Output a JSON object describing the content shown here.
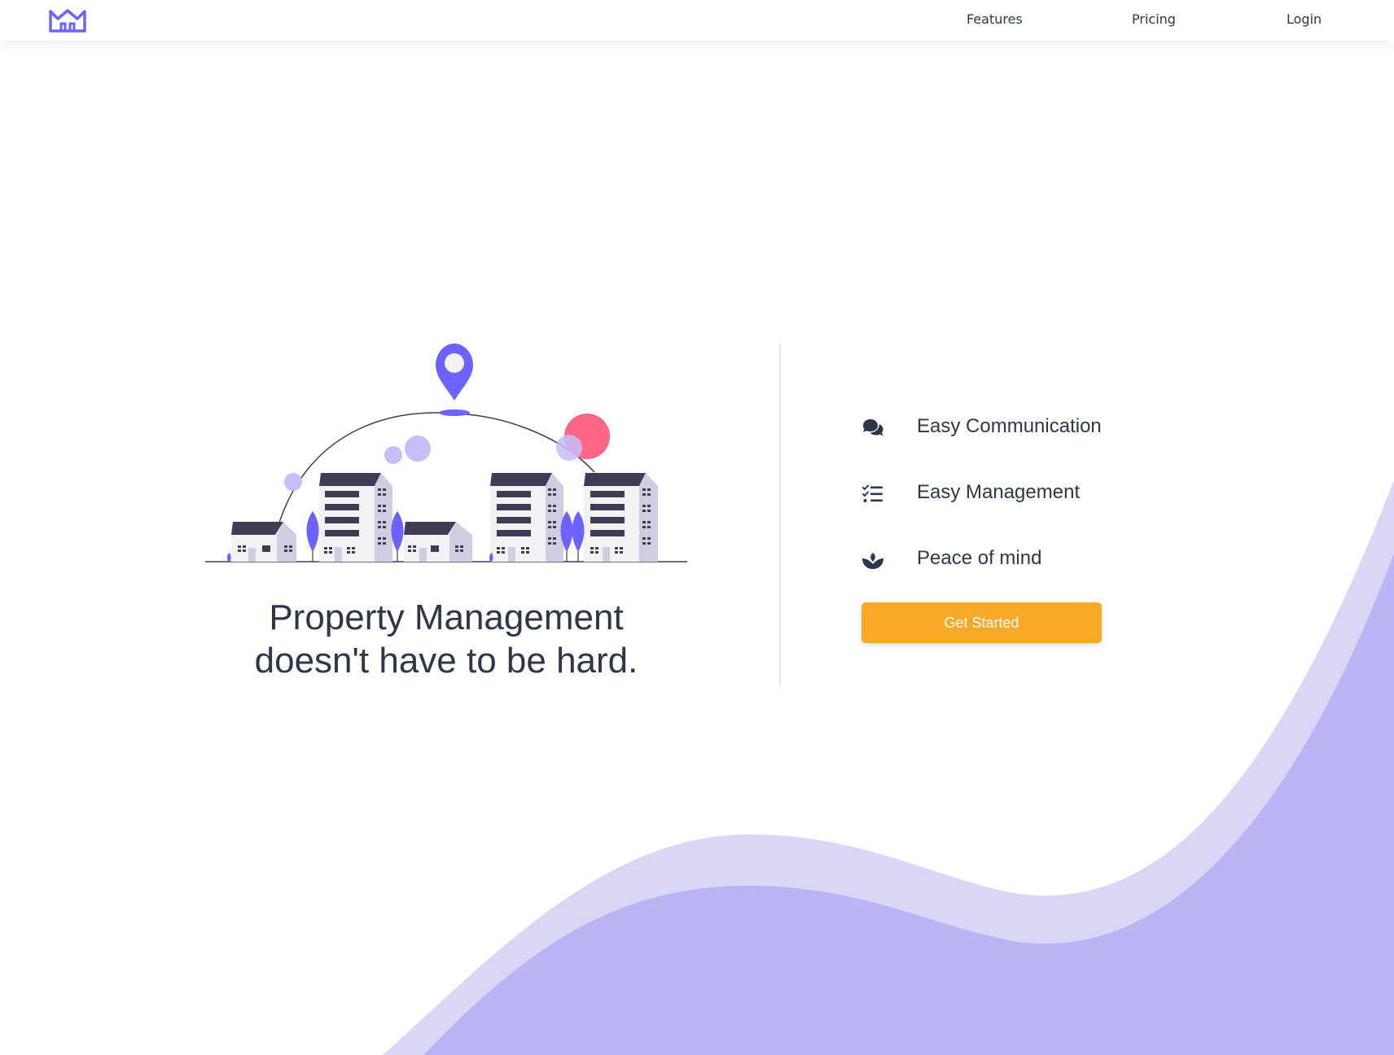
{
  "header": {
    "logo_icon": "crown-house-logo-icon",
    "nav": {
      "features": "Features",
      "pricing": "Pricing",
      "login": "Login"
    }
  },
  "hero": {
    "illustration": "city-buildings-location-pin-illustration",
    "headline_line1": "Property Management",
    "headline_line2": "doesn't have to be hard."
  },
  "features": [
    {
      "icon": "comments-icon",
      "label": "Easy Communication"
    },
    {
      "icon": "checklist-icon",
      "label": "Easy Management"
    },
    {
      "icon": "lotus-icon",
      "label": "Peace of mind"
    }
  ],
  "cta": {
    "label": "Get Started"
  },
  "colors": {
    "brand_purple": "#6c63ff",
    "wave_light": "#dad7f6",
    "wave_dark": "#b9b5f5",
    "cta_orange": "#f9a928",
    "text_dark": "#2d3748",
    "accent_pink": "#ff6584"
  }
}
